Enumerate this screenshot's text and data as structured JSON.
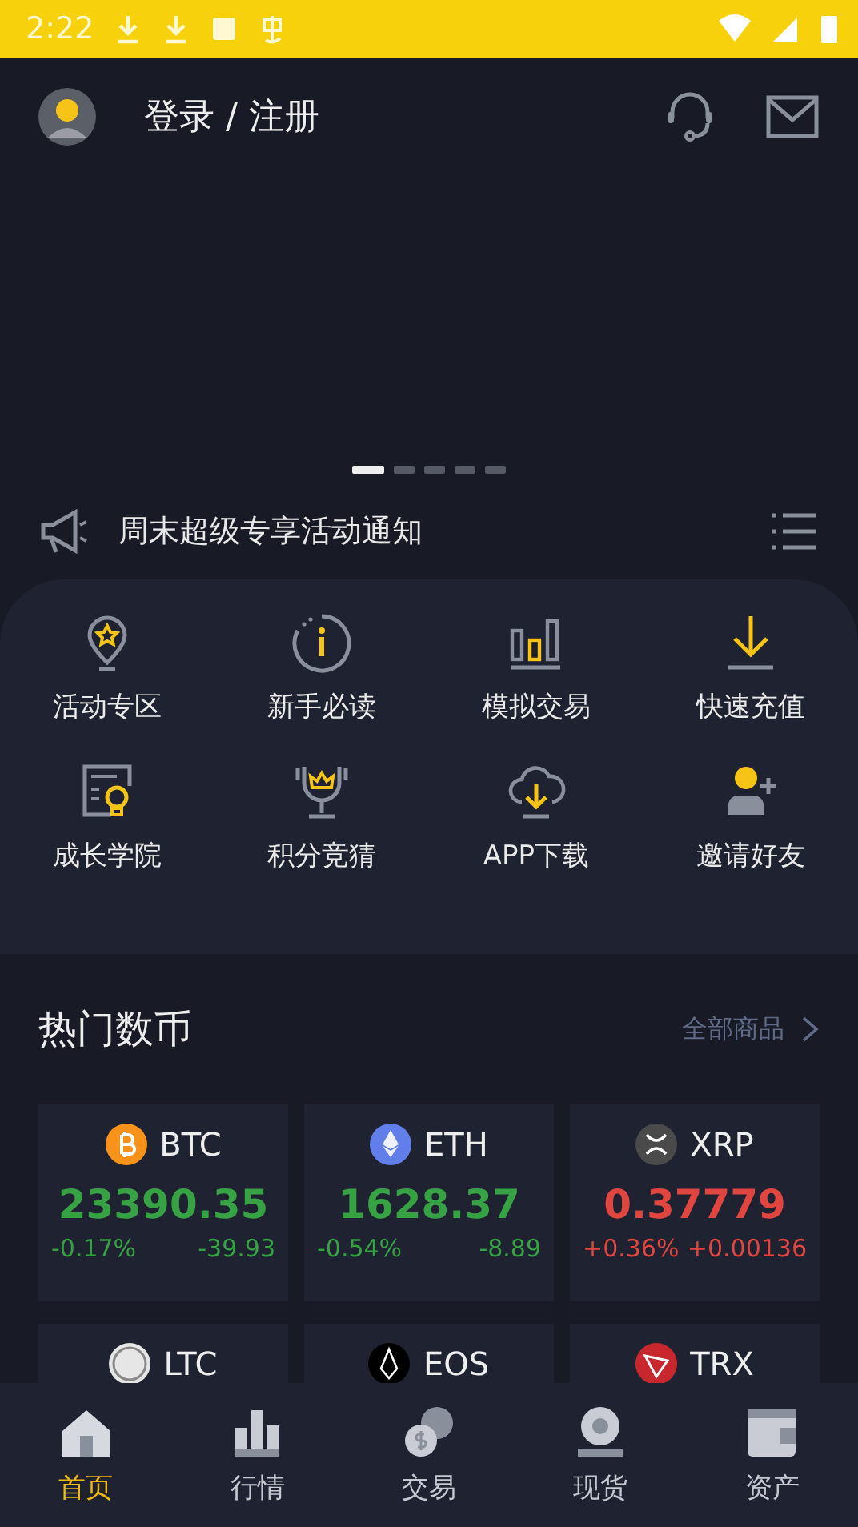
{
  "status_bar": {
    "time": "2:22"
  },
  "header": {
    "title": "登录 / 注册"
  },
  "banner": {
    "dots": [
      {
        "selected": true
      },
      {
        "selected": false
      },
      {
        "selected": false
      },
      {
        "selected": false
      },
      {
        "selected": false
      }
    ]
  },
  "notice": {
    "text": "周末超级专享活动通知"
  },
  "shortcuts": [
    {
      "label": "活动专区",
      "kind": "pin"
    },
    {
      "label": "新手必读",
      "kind": "info"
    },
    {
      "label": "模拟交易",
      "kind": "bars"
    },
    {
      "label": "快速充值",
      "kind": "download"
    },
    {
      "label": "成长学院",
      "kind": "bulb"
    },
    {
      "label": "积分竞猜",
      "kind": "trophy"
    },
    {
      "label": "APP下载",
      "kind": "cloud"
    },
    {
      "label": "邀请好友",
      "kind": "invite"
    }
  ],
  "hot": {
    "title": "热门数币",
    "link": "全部商品"
  },
  "coins": [
    {
      "kind": "btc",
      "symbol": "BTC",
      "price": "23390.35",
      "change_pct": "-0.17%",
      "change": "-39.93",
      "rising": false
    },
    {
      "kind": "eth",
      "symbol": "ETH",
      "price": "1628.37",
      "change_pct": "-0.54%",
      "change": "-8.89",
      "rising": false
    },
    {
      "kind": "xrp",
      "symbol": "XRP",
      "price": "0.37779",
      "change_pct": "+0.36%",
      "change": "+0.00136",
      "rising": true
    },
    {
      "kind": "ltc",
      "symbol": "LTC"
    },
    {
      "kind": "eos",
      "symbol": "EOS"
    },
    {
      "kind": "trx",
      "symbol": "TRX"
    }
  ],
  "tabs": [
    {
      "label": "首页",
      "kind": "home",
      "selected": true
    },
    {
      "label": "行情",
      "kind": "chart",
      "selected": false
    },
    {
      "label": "交易",
      "kind": "coins",
      "selected": false
    },
    {
      "label": "现货",
      "kind": "spot",
      "selected": false
    },
    {
      "label": "资产",
      "kind": "wallet",
      "selected": false
    }
  ]
}
